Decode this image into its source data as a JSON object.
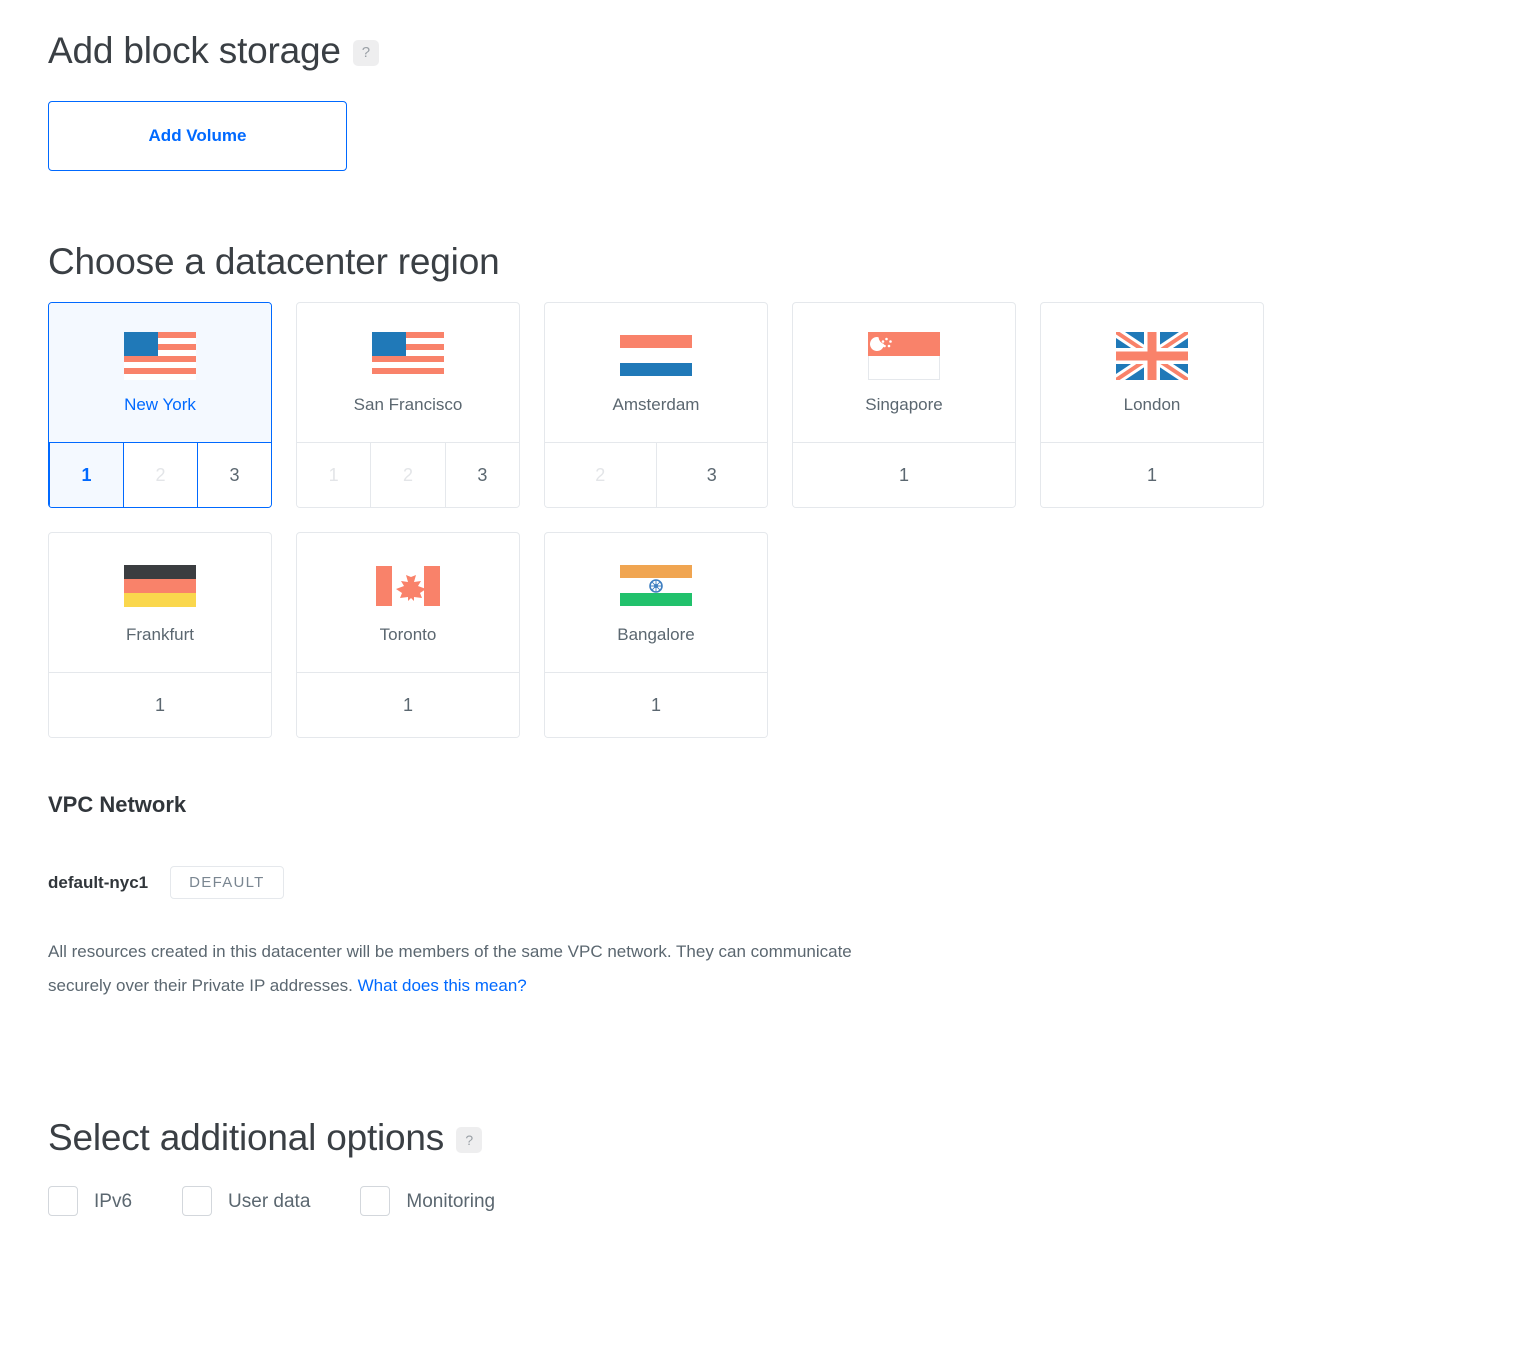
{
  "block_storage": {
    "title": "Add block storage",
    "help_icon": "?",
    "add_volume_label": "Add Volume"
  },
  "regions": {
    "title": "Choose a datacenter region",
    "cards": [
      {
        "name": "New York",
        "flag": "us-flag-icon",
        "selected": true,
        "slots": [
          {
            "label": "1",
            "state": "active"
          },
          {
            "label": "2",
            "state": "disabled"
          },
          {
            "label": "3",
            "state": "enabled"
          }
        ]
      },
      {
        "name": "San Francisco",
        "flag": "us-flag-icon",
        "selected": false,
        "slots": [
          {
            "label": "1",
            "state": "disabled"
          },
          {
            "label": "2",
            "state": "disabled"
          },
          {
            "label": "3",
            "state": "enabled"
          }
        ]
      },
      {
        "name": "Amsterdam",
        "flag": "netherlands-flag-icon",
        "selected": false,
        "slots": [
          {
            "label": "2",
            "state": "disabled"
          },
          {
            "label": "3",
            "state": "enabled"
          }
        ]
      },
      {
        "name": "Singapore",
        "flag": "singapore-flag-icon",
        "selected": false,
        "slots": [
          {
            "label": "1",
            "state": "enabled"
          }
        ]
      },
      {
        "name": "London",
        "flag": "uk-flag-icon",
        "selected": false,
        "slots": [
          {
            "label": "1",
            "state": "enabled"
          }
        ]
      },
      {
        "name": "Frankfurt",
        "flag": "germany-flag-icon",
        "selected": false,
        "slots": [
          {
            "label": "1",
            "state": "enabled"
          }
        ]
      },
      {
        "name": "Toronto",
        "flag": "canada-flag-icon",
        "selected": false,
        "slots": [
          {
            "label": "1",
            "state": "enabled"
          }
        ]
      },
      {
        "name": "Bangalore",
        "flag": "india-flag-icon",
        "selected": false,
        "slots": [
          {
            "label": "1",
            "state": "enabled"
          }
        ]
      }
    ]
  },
  "vpc": {
    "title": "VPC Network",
    "network_name": "default-nyc1",
    "default_badge": "DEFAULT",
    "description_part1": "All resources created in this datacenter will be members of the same VPC network. They can communicate securely over their Private IP addresses. ",
    "description_link": "What does this mean?"
  },
  "additional_options": {
    "title": "Select additional options",
    "help_icon": "?",
    "options": [
      {
        "label": "IPv6",
        "checked": false
      },
      {
        "label": "User data",
        "checked": false
      },
      {
        "label": "Monitoring",
        "checked": false
      }
    ]
  },
  "colors": {
    "accent_blue": "#0069ff",
    "selected_bg": "#f4f9ff",
    "border_gray": "#e5e8ec",
    "flag_salmon": "#f9826a",
    "flag_blue": "#2079b8",
    "flag_yellow": "#fad74d",
    "flag_dark": "#3b3d40",
    "flag_orange": "#f0a551",
    "flag_green": "#21c16c"
  }
}
